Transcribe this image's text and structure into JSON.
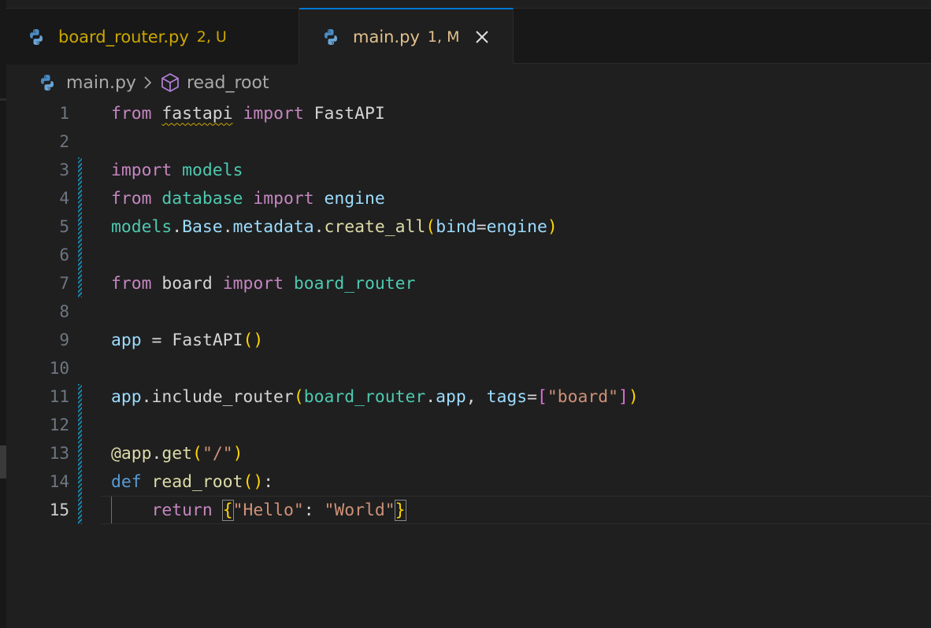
{
  "tabs": [
    {
      "name": "board_router.py",
      "status": "2, U",
      "active": false
    },
    {
      "name": "main.py",
      "status": "1, M",
      "active": true
    }
  ],
  "breadcrumb": {
    "file": "main.py",
    "symbol": "read_root"
  },
  "editor": {
    "language": "python",
    "current_line": 15,
    "line_numbers": [
      "1",
      "2",
      "3",
      "4",
      "5",
      "6",
      "7",
      "8",
      "9",
      "10",
      "11",
      "12",
      "13",
      "14",
      "15"
    ],
    "lines": [
      "from fastapi import FastAPI",
      "",
      "import models",
      "from database import engine",
      "models.Base.metadata.create_all(bind=engine)",
      "",
      "from board import board_router",
      "",
      "app = FastAPI()",
      "",
      "app.include_router(board_router.app, tags=[\"board\"])",
      "",
      "@app.get(\"/\")",
      "def read_root():",
      "    return {\"Hello\": \"World\"}"
    ],
    "modified_ranges": [
      [
        3,
        7
      ],
      [
        11,
        15
      ]
    ],
    "warning_token": "fastapi"
  },
  "colors": {
    "accent": "#0078d4",
    "keyword": "#c586c0",
    "module": "#4ec9b0",
    "string": "#ce9178",
    "function": "#dcdcaa",
    "variable": "#9cdcfe",
    "warning": "#cca700"
  },
  "icons": [
    "python-file-icon",
    "close-icon",
    "chevron-right-icon",
    "cube-icon"
  ]
}
